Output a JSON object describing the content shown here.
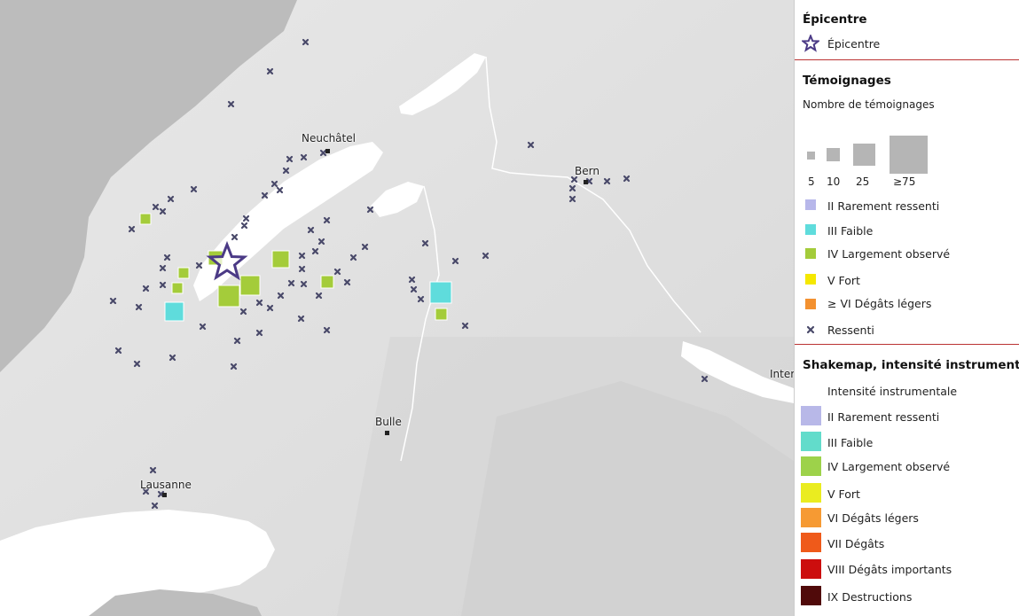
{
  "map": {
    "cities": [
      {
        "name": "Neuchâtel"
      },
      {
        "name": "Bern"
      },
      {
        "name": "Bulle"
      },
      {
        "name": "Lausanne"
      },
      {
        "name": "Inter"
      }
    ]
  },
  "legend": {
    "epicentre_title": "Épicentre",
    "epicentre_label": "Épicentre",
    "temoignages_title": "Témoignages",
    "nombre_label": "Nombre de témoignages",
    "sizes": [
      "5",
      "10",
      "25",
      "≥75"
    ],
    "testimony_classes": [
      {
        "label": "II Rarement ressenti",
        "color": "#b7b7ea"
      },
      {
        "label": "III Faible",
        "color": "#5fdcdc"
      },
      {
        "label": "IV Largement observé",
        "color": "#a4cc3a"
      },
      {
        "label": "V Fort",
        "color": "#f5e800"
      },
      {
        "label": "≥ VI Dégâts légers",
        "color": "#f39130"
      }
    ],
    "ressenti_label": "Ressenti",
    "shakemap_title": "Shakemap, intensité instrumentale",
    "intensity_header": "Intensité instrumentale",
    "shakemap_classes": [
      {
        "label": "II Rarement ressenti",
        "color": "#b8b8e8"
      },
      {
        "label": "III Faible",
        "color": "#62dccb"
      },
      {
        "label": "IV Largement observé",
        "color": "#9dd24a"
      },
      {
        "label": "V Fort",
        "color": "#eaec20"
      },
      {
        "label": "VI Dégâts légers",
        "color": "#f69a33"
      },
      {
        "label": "VII Dégâts",
        "color": "#ef5a1a"
      },
      {
        "label": "VIII Dégâts importants",
        "color": "#cc0e0e"
      },
      {
        "label": "IX Destructions",
        "color": "#500a0a"
      }
    ]
  },
  "colors": {
    "epicentre_star": "#4b3a86",
    "ressenti_marker": "#4a4a6a",
    "separator": "#b33333"
  }
}
